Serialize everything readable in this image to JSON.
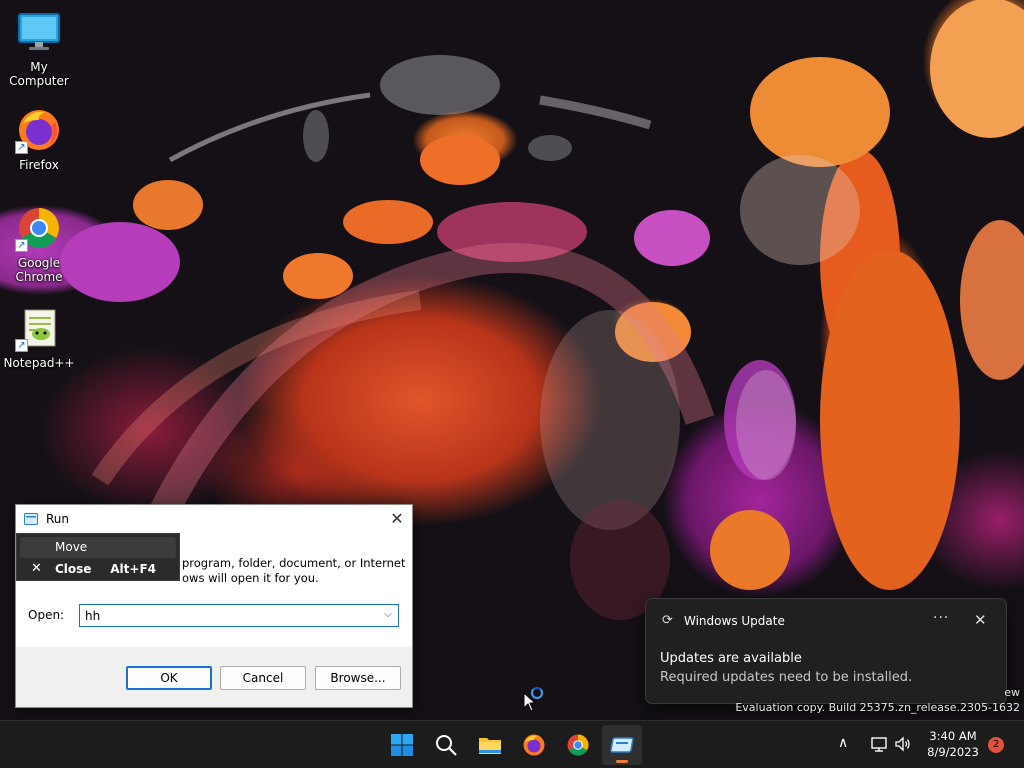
{
  "desktop": {
    "icons": [
      {
        "label": "My Computer",
        "icon": "monitor-icon"
      },
      {
        "label": "Firefox",
        "icon": "firefox-icon"
      },
      {
        "label": "Google Chrome",
        "icon": "chrome-icon"
      },
      {
        "label": "Notepad++",
        "icon": "notepadpp-icon"
      }
    ],
    "shortcut_glyph": "↗"
  },
  "run_dialog": {
    "title": "Run",
    "close_glyph": "✕",
    "description_line1": "program, folder, document, or Internet",
    "description_line2": "ows will open it for you.",
    "open_label": "Open:",
    "input_value": "hh",
    "dropdown_glyph": "⌵",
    "buttons": {
      "ok": "OK",
      "cancel": "Cancel",
      "browse": "Browse..."
    },
    "context_menu": {
      "move_label": "Move",
      "close_glyph": "✕",
      "close_label": "Close",
      "close_shortcut": "Alt+F4"
    }
  },
  "notification": {
    "sync_glyph": "⟳",
    "app_name": "Windows Update",
    "more_glyph": "···",
    "close_glyph": "✕",
    "title": "Updates are available",
    "body": "Required updates need to be installed."
  },
  "watermark": {
    "line1": "ew",
    "line2": "Evaluation copy. Build 25375.zn_release.2305-1632"
  },
  "taskbar": {
    "apps": [
      {
        "name": "start",
        "icon": "windows-start-icon"
      },
      {
        "name": "search",
        "icon": "search-icon"
      },
      {
        "name": "file-explorer",
        "icon": "folder-icon"
      },
      {
        "name": "firefox",
        "icon": "firefox-icon"
      },
      {
        "name": "chrome",
        "icon": "chrome-icon"
      },
      {
        "name": "run",
        "icon": "run-app-icon",
        "active": true
      }
    ],
    "tray": {
      "chevron_glyph": "∧",
      "time": "3:40 AM",
      "date": "8/9/2023",
      "notification_count": "2"
    }
  },
  "colors": {
    "taskbar_bg": "#1c1c1c",
    "accent": "#1a6fd6",
    "active_indicator": "#f07c2e",
    "badge": "#e0543a"
  }
}
